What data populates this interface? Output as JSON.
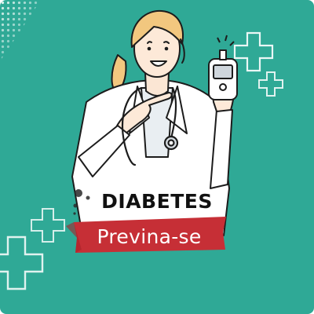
{
  "card": {
    "title": "DIABETES",
    "subtitle": "Previna-se"
  },
  "icons": {
    "doctor": "doctor-illustration",
    "meter": "glucose-meter-icon",
    "stethoscope": "stethoscope-icon",
    "crosses": "medical-cross-icon",
    "dots": "halftone-dots-decoration"
  },
  "colors": {
    "background": "#2fa996",
    "ribbon": "#c62f36",
    "hair": "#f2c77f",
    "coat": "#ffffff",
    "outline": "#1c1c1c"
  }
}
